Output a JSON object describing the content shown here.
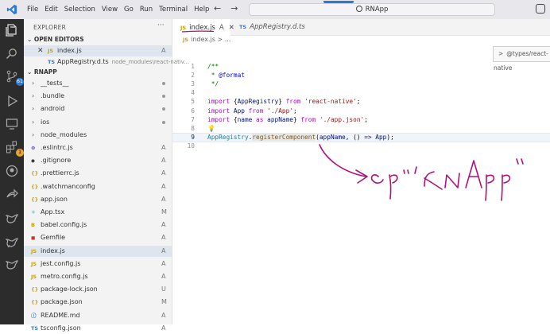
{
  "titlebar": {
    "menu": [
      "File",
      "Edit",
      "Selection",
      "View",
      "Go",
      "Run",
      "Terminal",
      "Help"
    ],
    "search_label": "RNApp",
    "icons": {
      "logo": "vscode-logo-icon",
      "back": "arrow-left-icon",
      "forward": "arrow-right-icon",
      "search": "search-icon",
      "account": "copilot-icon"
    }
  },
  "activity_bar": {
    "items": [
      "explorer-icon",
      "search-icon",
      "source-control-icon",
      "run-debug-icon",
      "remote-explorer-icon",
      "extensions-icon",
      "github-icon",
      "share-icon",
      "bird-icon-1",
      "bird-icon-2",
      "bird-icon-3"
    ],
    "source_control_badge": "61",
    "extensions_badge": "1"
  },
  "sidebar": {
    "header": "EXPLORER",
    "more": "···",
    "open_editors_label": "OPEN EDITORS",
    "open_editors": [
      {
        "icon": "JS",
        "name": "index.js",
        "path": "",
        "status": "A",
        "active": true,
        "close": "✕"
      },
      {
        "icon": "TS",
        "name": "AppRegistry.d.ts",
        "path": "node_modules\\react-nativ...",
        "status": "",
        "active": false
      }
    ],
    "project_label": "RNAPP",
    "tree": [
      {
        "kind": "folder",
        "name": "__tests__",
        "status": "dot"
      },
      {
        "kind": "folder",
        "name": ".bundle",
        "status": "dot"
      },
      {
        "kind": "folder",
        "name": "android",
        "status": "dot"
      },
      {
        "kind": "folder",
        "name": "ios",
        "status": "dot"
      },
      {
        "kind": "folder",
        "name": "node_modules",
        "status": ""
      },
      {
        "kind": "file",
        "icon": "⊛",
        "icolor": "#6c4bb8",
        "name": ".eslintrc.js",
        "status": "A"
      },
      {
        "kind": "file",
        "icon": "◆",
        "icolor": "#333333",
        "name": ".gitignore",
        "status": "A"
      },
      {
        "kind": "file",
        "icon": "{}",
        "icolor": "#c7a300",
        "name": ".prettierrc.js",
        "status": "A"
      },
      {
        "kind": "file",
        "icon": "{}",
        "icolor": "#c7a300",
        "name": ".watchmanconfig",
        "status": "A"
      },
      {
        "kind": "file",
        "icon": "{}",
        "icolor": "#c7a300",
        "name": "app.json",
        "status": "A"
      },
      {
        "kind": "file",
        "icon": "⚛",
        "icolor": "#1a9fd1",
        "name": "App.tsx",
        "status": "M"
      },
      {
        "kind": "file",
        "icon": "B",
        "icolor": "#c7a300",
        "name": "babel.config.js",
        "status": "A"
      },
      {
        "kind": "file",
        "icon": "◼",
        "icolor": "#c0392b",
        "name": "Gemfile",
        "status": "A"
      },
      {
        "kind": "file",
        "icon": "JS",
        "icolor": "#c7a300",
        "name": "index.js",
        "status": "A",
        "active": true
      },
      {
        "kind": "file",
        "icon": "JS",
        "icolor": "#c7a300",
        "name": "jest.config.js",
        "status": "A"
      },
      {
        "kind": "file",
        "icon": "JS",
        "icolor": "#c7a300",
        "name": "metro.config.js",
        "status": "A"
      },
      {
        "kind": "file",
        "icon": "{}",
        "icolor": "#c7a300",
        "name": "package-lock.json",
        "status": "U"
      },
      {
        "kind": "file",
        "icon": "{}",
        "icolor": "#c7a300",
        "name": "package.json",
        "status": "M"
      },
      {
        "kind": "file",
        "icon": "ⓘ",
        "icolor": "#2f7ad1",
        "name": "README.md",
        "status": "A"
      },
      {
        "kind": "file",
        "icon": "TS",
        "icolor": "#2f7ad1",
        "name": "tsconfig.json",
        "status": "A"
      }
    ]
  },
  "editor": {
    "tabs": [
      {
        "icon": "JS",
        "name": "index.js",
        "status": "A",
        "close": "✕",
        "active": true
      },
      {
        "icon": "TS",
        "name": "AppRegistry.d.ts",
        "active": false
      }
    ],
    "breadcrumb": {
      "icon": "JS",
      "file": "index.js",
      "sep": ">",
      "rest": "..."
    },
    "hover": {
      "chevron": ">",
      "text": "@types/react-native"
    },
    "lines": [
      {
        "n": "1",
        "tokens": [
          [
            "cmt",
            "/**"
          ]
        ]
      },
      {
        "n": "2",
        "tokens": [
          [
            "cmt",
            " * "
          ],
          [
            "tag",
            "@format"
          ]
        ]
      },
      {
        "n": "3",
        "tokens": [
          [
            "cmt",
            " */"
          ]
        ]
      },
      {
        "n": "4",
        "tokens": []
      },
      {
        "n": "5",
        "tokens": [
          [
            "kw",
            "import"
          ],
          [
            "pl",
            " {"
          ],
          [
            "id",
            "AppRegistry"
          ],
          [
            "pl",
            "} "
          ],
          [
            "kw",
            "from"
          ],
          [
            "pl",
            " "
          ],
          [
            "str",
            "'react-native'"
          ],
          [
            "pl",
            ";"
          ]
        ]
      },
      {
        "n": "6",
        "tokens": [
          [
            "kw",
            "import"
          ],
          [
            "pl",
            " "
          ],
          [
            "id",
            "App"
          ],
          [
            "pl",
            " "
          ],
          [
            "kw",
            "from"
          ],
          [
            "pl",
            " "
          ],
          [
            "str",
            "'./App'"
          ],
          [
            "pl",
            ";"
          ]
        ]
      },
      {
        "n": "7",
        "tokens": [
          [
            "kw",
            "import"
          ],
          [
            "pl",
            " {"
          ],
          [
            "id",
            "name"
          ],
          [
            "pl",
            " "
          ],
          [
            "kw",
            "as"
          ],
          [
            "pl",
            " "
          ],
          [
            "id",
            "appName"
          ],
          [
            "pl",
            "} "
          ],
          [
            "kw",
            "from"
          ],
          [
            "pl",
            " "
          ],
          [
            "str",
            "'./app.json'"
          ],
          [
            "pl",
            ";"
          ]
        ]
      },
      {
        "n": "8",
        "tokens": [],
        "bulb": "💡"
      },
      {
        "n": "9",
        "tokens": [
          [
            "cls",
            "AppRegistry"
          ],
          [
            "pl",
            "."
          ],
          [
            "fn",
            "registerComponent"
          ],
          [
            "pl",
            "("
          ],
          [
            "id",
            "appName"
          ],
          [
            "pl",
            ", () "
          ],
          [
            "op",
            "=>"
          ],
          [
            "pl",
            " "
          ],
          [
            "id",
            "App"
          ],
          [
            "pl",
            ");"
          ]
        ],
        "current": true
      },
      {
        "n": "10",
        "tokens": []
      }
    ]
  },
  "annotation": {
    "handwritten_text": "->ep 'RNApp'",
    "ink_color": "#b0117a"
  }
}
